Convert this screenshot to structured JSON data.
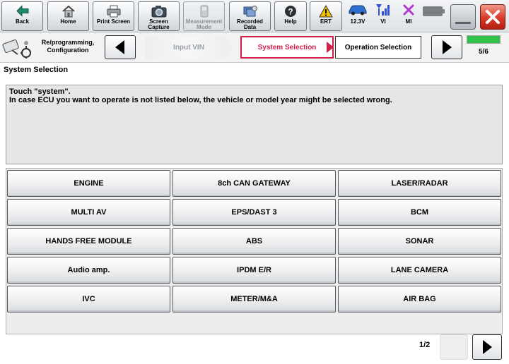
{
  "toolbar": {
    "back": "Back",
    "home": "Home",
    "print_screen": "Print Screen",
    "screen_capture": "Screen\nCapture",
    "measurement_mode": "Measurement\nMode",
    "recorded_data": "Recorded\nData",
    "help": "Help",
    "ert": "ERT",
    "voltage": "12.3V",
    "vi": "VI",
    "mi": "MI"
  },
  "nav": {
    "mode_label": "Re/programming,\nConfiguration",
    "steps": {
      "input_vin": "Input VIN",
      "system_selection": "System Selection",
      "operation_selection": "Operation Selection"
    },
    "progress_text": "5/6",
    "progress_fraction": 1.0
  },
  "page_title": "System Selection",
  "instructions": {
    "line1": "Touch \"system\".",
    "line2": "In case ECU you want to operate is not listed below, the vehicle or model year might be selected wrong."
  },
  "systems": [
    "ENGINE",
    "8ch CAN GATEWAY",
    "LASER/RADAR",
    "MULTI AV",
    "EPS/DAST 3",
    "BCM",
    "HANDS FREE MODULE",
    "ABS",
    "SONAR",
    "Audio amp.",
    "IPDM E/R",
    "LANE CAMERA",
    "IVC",
    "METER/M&A",
    "AIR BAG"
  ],
  "pagination": {
    "indicator": "1/2"
  },
  "colors": {
    "active_step": "#d0204a",
    "progress_fill": "#2fc34a",
    "close_button": "#d83a2a",
    "ert_warning": "#f2c400",
    "signal": "#2f4fd8",
    "mi_cross": "#b03ad0"
  }
}
